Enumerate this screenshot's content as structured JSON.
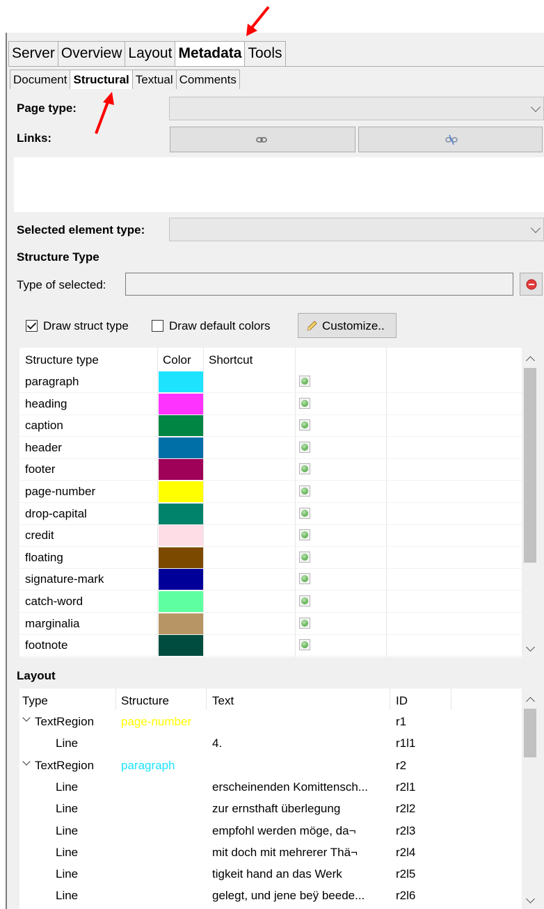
{
  "main_tabs": [
    "Server",
    "Overview",
    "Layout",
    "Metadata",
    "Tools"
  ],
  "main_tab_active": "Metadata",
  "sub_tabs": [
    "Document",
    "Structural",
    "Textual",
    "Comments"
  ],
  "sub_tab_active": "Structural",
  "page_type": {
    "label": "Page type:",
    "value": ""
  },
  "links": {
    "label": "Links:",
    "link_icon": "link-icon",
    "unlink_icon": "unlink-icon"
  },
  "selected_element_type": {
    "label": "Selected element type:",
    "value": ""
  },
  "structure_type": {
    "heading": "Structure Type",
    "type_of_selected_label": "Type of selected:",
    "type_of_selected_value": "",
    "draw_struct_type_label": "Draw struct type",
    "draw_struct_type_checked": true,
    "draw_default_colors_label": "Draw default colors",
    "draw_default_colors_checked": false,
    "customize_label": "Customize.."
  },
  "structure_table": {
    "columns": [
      "Structure type",
      "Color",
      "Shortcut"
    ],
    "rows": [
      {
        "name": "paragraph",
        "color": "#1ee3ff"
      },
      {
        "name": "heading",
        "color": "#ff33ff"
      },
      {
        "name": "caption",
        "color": "#008542"
      },
      {
        "name": "header",
        "color": "#006fa8"
      },
      {
        "name": "footer",
        "color": "#9f0058"
      },
      {
        "name": "page-number",
        "color": "#ffff00"
      },
      {
        "name": "drop-capital",
        "color": "#00826b"
      },
      {
        "name": "credit",
        "color": "#ffdde6"
      },
      {
        "name": "floating",
        "color": "#7b4a00"
      },
      {
        "name": "signature-mark",
        "color": "#000099"
      },
      {
        "name": "catch-word",
        "color": "#5effa0"
      },
      {
        "name": "marginalia",
        "color": "#b79564"
      },
      {
        "name": "footnote",
        "color": "#004d3f"
      }
    ]
  },
  "layout": {
    "heading": "Layout",
    "columns": [
      "Type",
      "Structure",
      "Text",
      "ID"
    ],
    "rows": [
      {
        "type": "TextRegion",
        "structure": "page-number",
        "structure_color": "#ffff00",
        "text": "",
        "id": "r1",
        "level": 0
      },
      {
        "type": "Line",
        "structure": "",
        "structure_color": "",
        "text": "4.",
        "id": "r1l1",
        "level": 1
      },
      {
        "type": "TextRegion",
        "structure": "paragraph",
        "structure_color": "#1ee3ff",
        "text": "",
        "id": "r2",
        "level": 0
      },
      {
        "type": "Line",
        "structure": "",
        "structure_color": "",
        "text": "erscheinenden Komittensch...",
        "id": "r2l1",
        "level": 1
      },
      {
        "type": "Line",
        "structure": "",
        "structure_color": "",
        "text": "zur ernsthaft überlegung",
        "id": "r2l2",
        "level": 1
      },
      {
        "type": "Line",
        "structure": "",
        "structure_color": "",
        "text": "empfohl werden möge, da¬",
        "id": "r2l3",
        "level": 1
      },
      {
        "type": "Line",
        "structure": "",
        "structure_color": "",
        "text": "mit doch mit mehrerer Thä¬",
        "id": "r2l4",
        "level": 1
      },
      {
        "type": "Line",
        "structure": "",
        "structure_color": "",
        "text": "tigkeit hand an das Werk",
        "id": "r2l5",
        "level": 1
      },
      {
        "type": "Line",
        "structure": "",
        "structure_color": "",
        "text": "gelegt, und jene beÿ beede...",
        "id": "r2l6",
        "level": 1
      }
    ]
  },
  "annotation_color": "#ff0000"
}
